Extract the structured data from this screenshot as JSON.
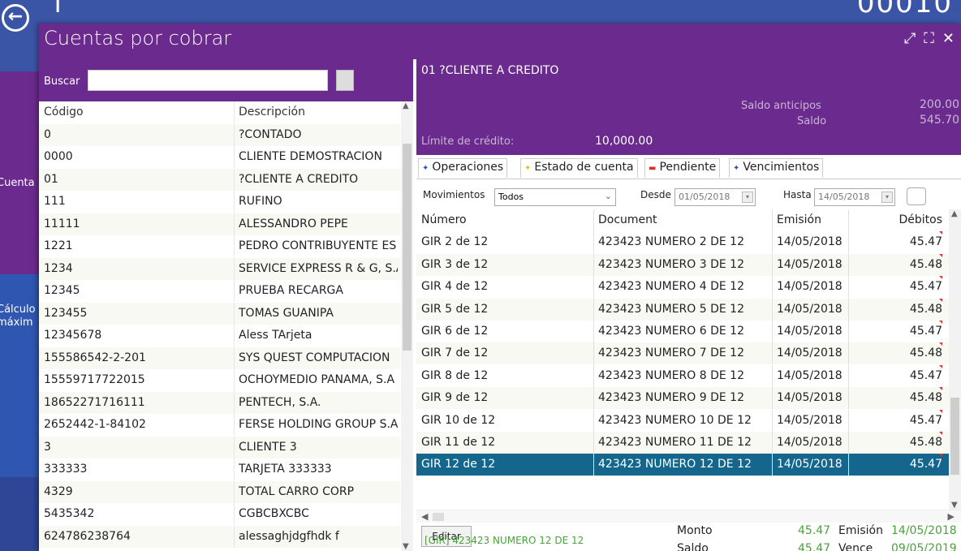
{
  "background": {
    "title": "T",
    "title_right": "00010",
    "side_items": [
      "Cuenta",
      "Cálculo",
      "máxim"
    ]
  },
  "dialog": {
    "title": "Cuentas por cobrar",
    "controls": [
      "⤢",
      "⛶",
      "✕"
    ]
  },
  "search": {
    "label": "Buscar",
    "value": "",
    "placeholder": ""
  },
  "clients_table": {
    "headers": [
      "Código",
      "Descripción"
    ],
    "rows": [
      [
        "0",
        "?CONTADO"
      ],
      [
        "0000",
        "CLIENTE DEMOSTRACION"
      ],
      [
        "01",
        "?CLIENTE A CREDITO"
      ],
      [
        "111",
        "RUFINO"
      ],
      [
        "11111",
        "ALESSANDRO PEPE"
      ],
      [
        "1221",
        "PEDRO CONTRIBUYENTE ES"
      ],
      [
        "1234",
        "SERVICE EXPRESS R & G, S.A"
      ],
      [
        "12345",
        "PRUEBA RECARGA"
      ],
      [
        "123455",
        "TOMAS GUANIPA"
      ],
      [
        "12345678",
        "Aless TArjeta"
      ],
      [
        "155586542-2-201",
        "SYS QUEST COMPUTACION"
      ],
      [
        "15559717722015",
        "OCHOYMEDIO PANAMA, S.A"
      ],
      [
        "18652271716111",
        "PENTECH, S.A."
      ],
      [
        "2652442-1-84102",
        "FERSE HOLDING GROUP S.A"
      ],
      [
        "3",
        "CLIENTE 3"
      ],
      [
        "333333",
        "TARJETA 333333"
      ],
      [
        "4329",
        "TOTAL CARRO CORP"
      ],
      [
        "5435342",
        "CGBCBXCBC"
      ],
      [
        "624786238764",
        "alessaghjdgfhdk f"
      ]
    ]
  },
  "client_detail": {
    "name": "01 ?CLIENTE A CREDITO",
    "saldo_anticipos_label": "Saldo anticipos",
    "saldo_anticipos_value": "200.00",
    "saldo_label": "Saldo",
    "saldo_value": "545.70",
    "limite_label": "Límite de crédito:",
    "limite_value": "10,000.00"
  },
  "tabs": [
    {
      "label": "Operaciones",
      "mark": "✦",
      "color": "#2f56b0"
    },
    {
      "label": "Estado de cuenta",
      "mark": "✦",
      "color": "#e0c020"
    },
    {
      "label": "Pendiente",
      "mark": "▬",
      "color": "#d33333"
    },
    {
      "label": "Vencimientos",
      "mark": "✦",
      "color": "#2f56b0"
    }
  ],
  "filters": {
    "movimientos_label": "Movimientos",
    "movimientos_value": "Todos",
    "desde_label": "Desde",
    "desde_value": "01/05/2018",
    "hasta_label": "Hasta",
    "hasta_value": "14/05/2018"
  },
  "operations_table": {
    "headers": [
      "Número",
      "Document",
      "Emisión",
      "Débitos"
    ],
    "rows": [
      [
        "GIR 2 de 12",
        "423423 NUMERO 2 DE 12",
        "14/05/2018",
        "45.47"
      ],
      [
        "GIR 3 de 12",
        "423423 NUMERO 3 DE 12",
        "14/05/2018",
        "45.48"
      ],
      [
        "GIR 4 de 12",
        "423423 NUMERO 4 DE 12",
        "14/05/2018",
        "45.47"
      ],
      [
        "GIR 5 de 12",
        "423423 NUMERO 5 DE 12",
        "14/05/2018",
        "45.48"
      ],
      [
        "GIR 6 de 12",
        "423423 NUMERO 6 DE 12",
        "14/05/2018",
        "45.47"
      ],
      [
        "GIR 7 de 12",
        "423423 NUMERO 7 DE 12",
        "14/05/2018",
        "45.48"
      ],
      [
        "GIR 8 de 12",
        "423423 NUMERO 8 DE 12",
        "14/05/2018",
        "45.47"
      ],
      [
        "GIR 9 de 12",
        "423423 NUMERO 9 DE 12",
        "14/05/2018",
        "45.48"
      ],
      [
        "GIR 10 de 12",
        "423423 NUMERO 10 DE 12",
        "14/05/2018",
        "45.47"
      ],
      [
        "GIR 11 de 12",
        "423423 NUMERO 11 DE 12",
        "14/05/2018",
        "45.48"
      ],
      [
        "GIR 12 de 12",
        "423423 NUMERO 12 DE 12",
        "14/05/2018",
        "45.47"
      ]
    ],
    "selected_index": 10
  },
  "footer": {
    "edit_label": "Editar",
    "monto_label": "Monto",
    "monto_value": "45.47",
    "emision_label": "Emisión",
    "emision_value": "14/05/2018",
    "saldo_label": "Saldo",
    "saldo_value": "45.47",
    "vence_label": "Vence",
    "vence_value": "09/05/2019",
    "status": "[GIR] 423423 NUMERO 12 DE 12"
  },
  "colors": {
    "purple": "#6b2a8d",
    "blue_bg": "#3b55a6",
    "selected_row": "#14668c",
    "green_text": "#4aa23a"
  }
}
